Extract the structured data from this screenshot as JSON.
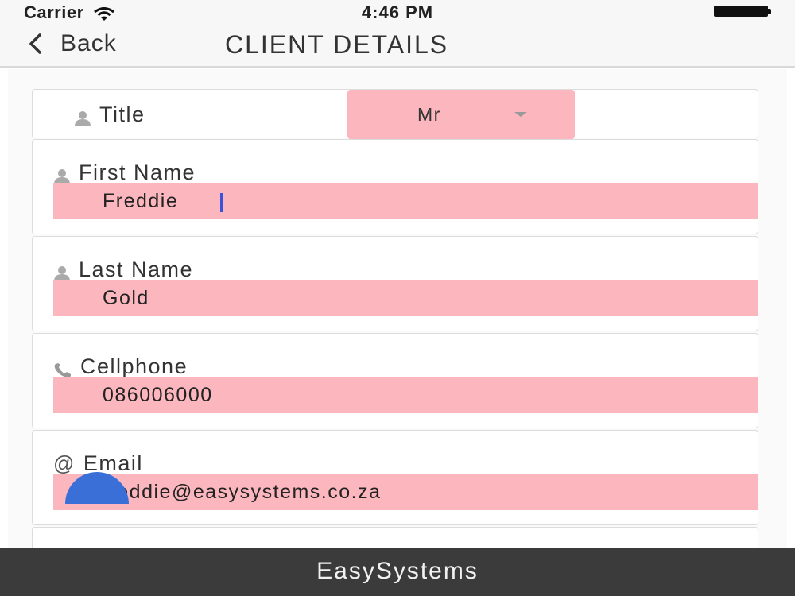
{
  "status_bar": {
    "carrier": "Carrier",
    "time": "4:46 PM"
  },
  "nav": {
    "back_label": "Back",
    "title": "CLIENT DETAILS"
  },
  "form": {
    "title_field": {
      "label": "Title",
      "value": "Mr",
      "icon": "person-icon"
    },
    "first_name": {
      "label": "First Name",
      "value": "Freddie",
      "icon": "person-icon"
    },
    "last_name": {
      "label": "Last Name",
      "value": "Gold",
      "icon": "person-icon"
    },
    "cellphone": {
      "label": "Cellphone",
      "value": "086006000",
      "icon": "phone-icon"
    },
    "email": {
      "label": "Email",
      "value": "freddie@easysystems.co.za",
      "icon": "at-icon",
      "icon_glyph": "@"
    }
  },
  "footer": {
    "brand": "EasySystems"
  },
  "colors": {
    "field_highlight": "#fbb6be",
    "footer_bg": "#3b3b3b",
    "fab_blue": "#3a6fd8",
    "cursor_blue": "#3b52d9"
  }
}
